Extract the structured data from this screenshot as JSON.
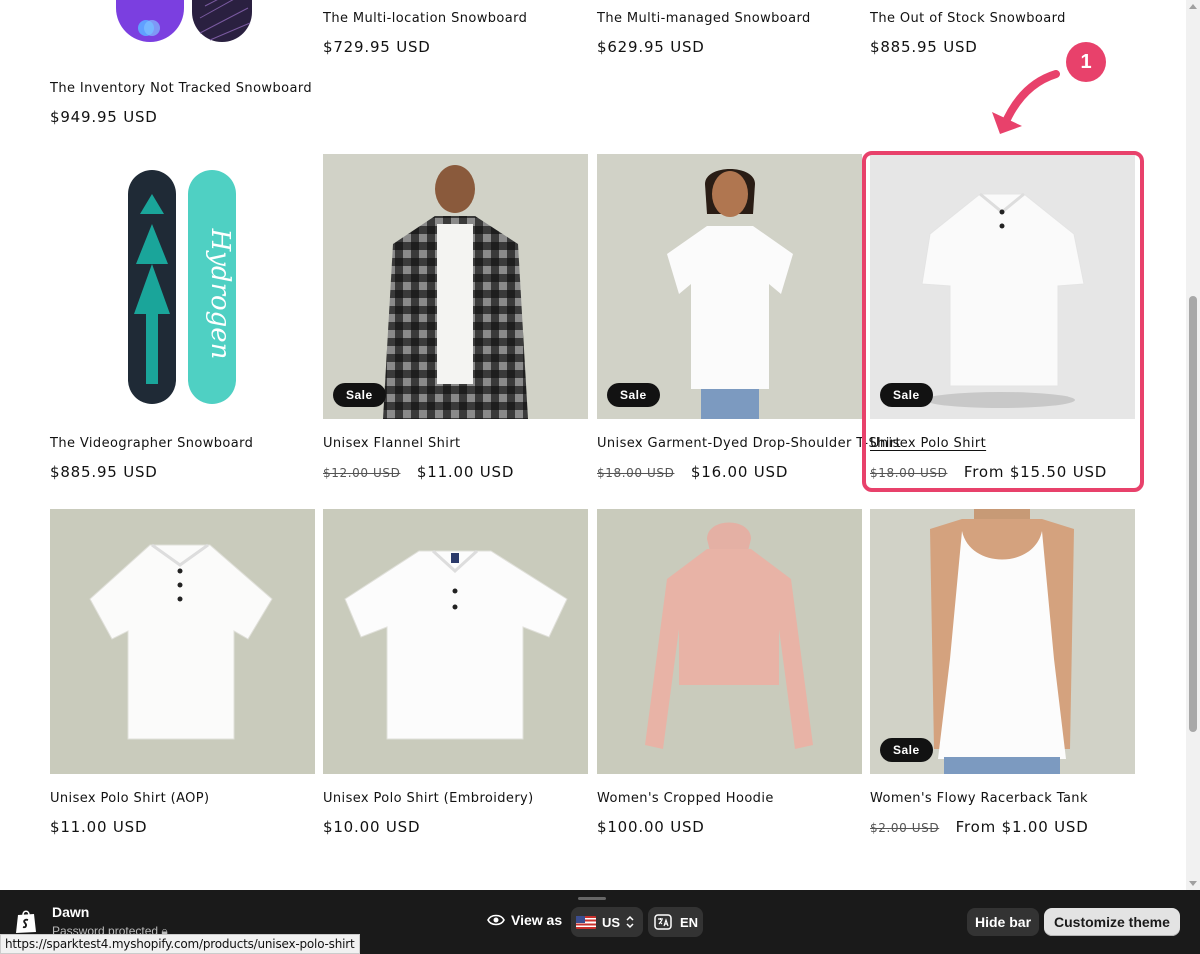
{
  "products": [
    {
      "title": "The Inventory Not Tracked Snowboard",
      "price": "$949.95 USD",
      "old_price": ""
    },
    {
      "title": "The Multi-location Snowboard",
      "price": "$729.95 USD",
      "old_price": ""
    },
    {
      "title": "The Multi-managed Snowboard",
      "price": "$629.95 USD",
      "old_price": ""
    },
    {
      "title": "The Out of Stock Snowboard",
      "price": "$885.95 USD",
      "old_price": ""
    },
    {
      "title": "The Videographer Snowboard",
      "price": "$885.95 USD",
      "old_price": ""
    },
    {
      "title": "Unisex Flannel Shirt",
      "price": "$11.00 USD",
      "old_price": "$12.00 USD",
      "badge": "Sale"
    },
    {
      "title": "Unisex Garment-Dyed Drop-Shoulder T-Shirt",
      "price": "$16.00 USD",
      "old_price": "$18.00 USD",
      "badge": "Sale"
    },
    {
      "title": "Unisex Polo Shirt",
      "price": "From $15.50 USD",
      "old_price": "$18.00 USD",
      "badge": "Sale"
    },
    {
      "title": "Unisex Polo Shirt (AOP)",
      "price": "$11.00 USD",
      "old_price": ""
    },
    {
      "title": "Unisex Polo Shirt (Embroidery)",
      "price": "$10.00 USD",
      "old_price": ""
    },
    {
      "title": "Women's Cropped Hoodie",
      "price": "$100.00 USD",
      "old_price": ""
    },
    {
      "title": "Women's Flowy Racerback Tank",
      "price": "From $1.00 USD",
      "old_price": "$2.00 USD",
      "badge": "Sale"
    }
  ],
  "annotation": {
    "marker": "1",
    "color": "#e8416b"
  },
  "preview_bar": {
    "theme_name": "Dawn",
    "theme_status": "Password protected",
    "view_as_label": "View as",
    "country": "US",
    "language": "EN",
    "hide_bar_label": "Hide bar",
    "customize_label": "Customize theme"
  },
  "status_url": "https://sparktest4.myshopify.com/products/unisex-polo-shirt",
  "icons": [
    "shopify-bag-icon",
    "eye-icon",
    "us-flag-icon",
    "chevron-updown-icon",
    "translate-icon",
    "lock-icon"
  ]
}
